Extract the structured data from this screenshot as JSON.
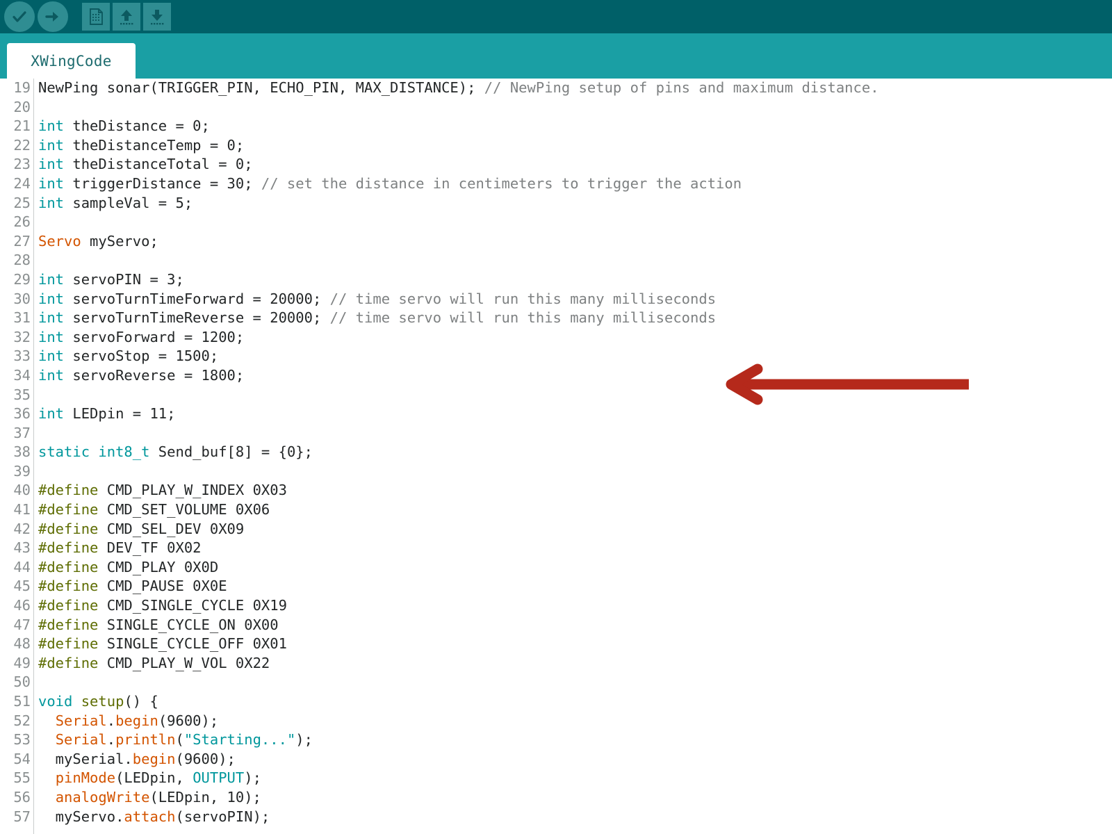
{
  "app": {
    "name": "Arduino IDE",
    "toolbar_bg": "#006068",
    "tabband_bg": "#1a9fa4",
    "button_bg": "#2f8d92"
  },
  "toolbar": {
    "buttons": [
      {
        "name": "verify-button",
        "icon": "check-icon",
        "label": "Verify",
        "shape": "round"
      },
      {
        "name": "upload-button",
        "icon": "right-arrow-icon",
        "label": "Upload",
        "shape": "round"
      },
      {
        "name": "new-button",
        "icon": "new-document-icon",
        "label": "New",
        "shape": "square"
      },
      {
        "name": "open-button",
        "icon": "up-arrow-icon",
        "label": "Open",
        "shape": "square"
      },
      {
        "name": "save-button",
        "icon": "down-arrow-icon",
        "label": "Save",
        "shape": "square"
      }
    ]
  },
  "tabs": {
    "active": "XWingCode",
    "items": [
      {
        "label": "XWingCode"
      }
    ]
  },
  "annotation": {
    "type": "arrow",
    "direction": "left",
    "color": "#b5291b",
    "points_at_lines": [
      30,
      31
    ]
  },
  "editor": {
    "first_visible_line": 19,
    "last_visible_line": 57,
    "colors": {
      "keyword": "#00979c",
      "library": "#d35400",
      "function": "#5e6d03",
      "preprocessor": "#5e6d03",
      "comment": "#7e8182",
      "string": "#00979c",
      "plain": "#232627",
      "line_number": "#8a8f90"
    },
    "lines": [
      {
        "n": 19,
        "tokens": [
          {
            "t": "NewPing sonar(TRIGGER_PIN, ECHO_PIN, MAX_DISTANCE); "
          },
          {
            "t": "// NewPing setup of pins and maximum distance.",
            "c": "cm"
          }
        ]
      },
      {
        "n": 20,
        "tokens": []
      },
      {
        "n": 21,
        "tokens": [
          {
            "t": "int",
            "c": "k"
          },
          {
            "t": " theDistance = 0;"
          }
        ]
      },
      {
        "n": 22,
        "tokens": [
          {
            "t": "int",
            "c": "k"
          },
          {
            "t": " theDistanceTemp = 0;"
          }
        ]
      },
      {
        "n": 23,
        "tokens": [
          {
            "t": "int",
            "c": "k"
          },
          {
            "t": " theDistanceTotal = 0;"
          }
        ]
      },
      {
        "n": 24,
        "tokens": [
          {
            "t": "int",
            "c": "k"
          },
          {
            "t": " triggerDistance = 30; "
          },
          {
            "t": "// set the distance in centimeters to trigger the action",
            "c": "cm"
          }
        ]
      },
      {
        "n": 25,
        "tokens": [
          {
            "t": "int",
            "c": "k"
          },
          {
            "t": " sampleVal = 5;"
          }
        ]
      },
      {
        "n": 26,
        "tokens": []
      },
      {
        "n": 27,
        "tokens": [
          {
            "t": "Servo",
            "c": "cl"
          },
          {
            "t": " myServo;"
          }
        ]
      },
      {
        "n": 28,
        "tokens": []
      },
      {
        "n": 29,
        "tokens": [
          {
            "t": "int",
            "c": "k"
          },
          {
            "t": " servoPIN = 3;"
          }
        ]
      },
      {
        "n": 30,
        "tokens": [
          {
            "t": "int",
            "c": "k"
          },
          {
            "t": " servoTurnTimeForward = 20000; "
          },
          {
            "t": "// time servo will run this many milliseconds",
            "c": "cm"
          }
        ]
      },
      {
        "n": 31,
        "tokens": [
          {
            "t": "int",
            "c": "k"
          },
          {
            "t": " servoTurnTimeReverse = 20000; "
          },
          {
            "t": "// time servo will run this many milliseconds",
            "c": "cm"
          }
        ]
      },
      {
        "n": 32,
        "tokens": [
          {
            "t": "int",
            "c": "k"
          },
          {
            "t": " servoForward = 1200;"
          }
        ]
      },
      {
        "n": 33,
        "tokens": [
          {
            "t": "int",
            "c": "k"
          },
          {
            "t": " servoStop = 1500;"
          }
        ]
      },
      {
        "n": 34,
        "tokens": [
          {
            "t": "int",
            "c": "k"
          },
          {
            "t": " servoReverse = 1800;"
          }
        ]
      },
      {
        "n": 35,
        "tokens": []
      },
      {
        "n": 36,
        "tokens": [
          {
            "t": "int",
            "c": "k"
          },
          {
            "t": " LEDpin = 11;"
          }
        ]
      },
      {
        "n": 37,
        "tokens": []
      },
      {
        "n": 38,
        "tokens": [
          {
            "t": "static",
            "c": "k"
          },
          {
            "t": " "
          },
          {
            "t": "int8_t",
            "c": "k"
          },
          {
            "t": " Send_buf[8] = {0};"
          }
        ]
      },
      {
        "n": 39,
        "tokens": []
      },
      {
        "n": 40,
        "tokens": [
          {
            "t": "#define",
            "c": "pp"
          },
          {
            "t": " CMD_PLAY_W_INDEX 0X03"
          }
        ]
      },
      {
        "n": 41,
        "tokens": [
          {
            "t": "#define",
            "c": "pp"
          },
          {
            "t": " CMD_SET_VOLUME 0X06"
          }
        ]
      },
      {
        "n": 42,
        "tokens": [
          {
            "t": "#define",
            "c": "pp"
          },
          {
            "t": " CMD_SEL_DEV 0X09"
          }
        ]
      },
      {
        "n": 43,
        "tokens": [
          {
            "t": "#define",
            "c": "pp"
          },
          {
            "t": " DEV_TF 0X02"
          }
        ]
      },
      {
        "n": 44,
        "tokens": [
          {
            "t": "#define",
            "c": "pp"
          },
          {
            "t": " CMD_PLAY 0X0D"
          }
        ]
      },
      {
        "n": 45,
        "tokens": [
          {
            "t": "#define",
            "c": "pp"
          },
          {
            "t": " CMD_PAUSE 0X0E"
          }
        ]
      },
      {
        "n": 46,
        "tokens": [
          {
            "t": "#define",
            "c": "pp"
          },
          {
            "t": " CMD_SINGLE_CYCLE 0X19"
          }
        ]
      },
      {
        "n": 47,
        "tokens": [
          {
            "t": "#define",
            "c": "pp"
          },
          {
            "t": " SINGLE_CYCLE_ON 0X00"
          }
        ]
      },
      {
        "n": 48,
        "tokens": [
          {
            "t": "#define",
            "c": "pp"
          },
          {
            "t": " SINGLE_CYCLE_OFF 0X01"
          }
        ]
      },
      {
        "n": 49,
        "tokens": [
          {
            "t": "#define",
            "c": "pp"
          },
          {
            "t": " CMD_PLAY_W_VOL 0X22"
          }
        ]
      },
      {
        "n": 50,
        "tokens": []
      },
      {
        "n": 51,
        "tokens": [
          {
            "t": "void",
            "c": "k"
          },
          {
            "t": " "
          },
          {
            "t": "setup",
            "c": "fn"
          },
          {
            "t": "() {"
          }
        ]
      },
      {
        "n": 52,
        "tokens": [
          {
            "t": "  "
          },
          {
            "t": "Serial",
            "c": "cl"
          },
          {
            "t": "."
          },
          {
            "t": "begin",
            "c": "cl"
          },
          {
            "t": "(9600);"
          }
        ]
      },
      {
        "n": 53,
        "tokens": [
          {
            "t": "  "
          },
          {
            "t": "Serial",
            "c": "cl"
          },
          {
            "t": "."
          },
          {
            "t": "println",
            "c": "cl"
          },
          {
            "t": "("
          },
          {
            "t": "\"Starting...\"",
            "c": "st"
          },
          {
            "t": ");"
          }
        ]
      },
      {
        "n": 54,
        "tokens": [
          {
            "t": "  mySerial."
          },
          {
            "t": "begin",
            "c": "cl"
          },
          {
            "t": "(9600);"
          }
        ]
      },
      {
        "n": 55,
        "tokens": [
          {
            "t": "  "
          },
          {
            "t": "pinMode",
            "c": "cl"
          },
          {
            "t": "(LEDpin, "
          },
          {
            "t": "OUTPUT",
            "c": "k"
          },
          {
            "t": ");"
          }
        ]
      },
      {
        "n": 56,
        "tokens": [
          {
            "t": "  "
          },
          {
            "t": "analogWrite",
            "c": "cl"
          },
          {
            "t": "(LEDpin, 10);"
          }
        ]
      },
      {
        "n": 57,
        "tokens": [
          {
            "t": "  myServo."
          },
          {
            "t": "attach",
            "c": "cl"
          },
          {
            "t": "(servoPIN);"
          }
        ]
      }
    ]
  }
}
